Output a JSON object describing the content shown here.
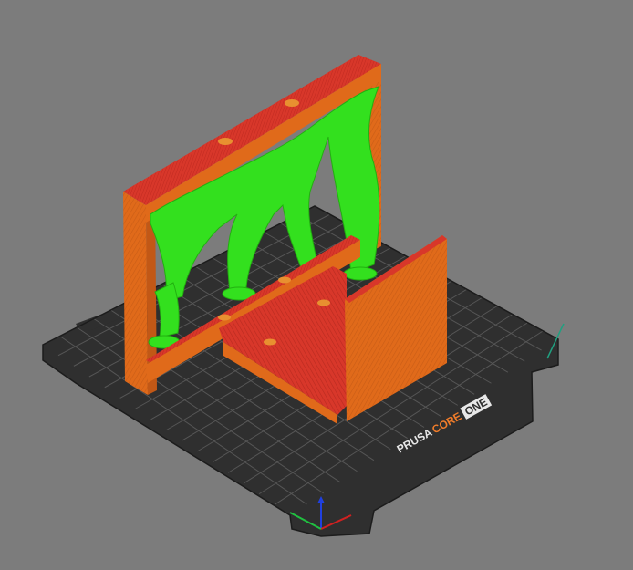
{
  "viewport": {
    "background_color": "#7c7c7c"
  },
  "bed": {
    "brand_part1": "PRUSA",
    "brand_part2": "CORE",
    "brand_part3": "ONE",
    "surface_color": "#2f2f2f",
    "grid_color": "#5a5a5a",
    "brand_accent_color": "#f07c2a"
  },
  "model": {
    "body_color": "#e06a1a",
    "top_layer_color": "#d8372a",
    "support_color": "#33e01e"
  },
  "axes": {
    "x_color": "#d02020",
    "y_color": "#20c040",
    "z_color": "#2040e0"
  },
  "icons": {
    "axes_gizmo": "axes-gizmo-icon",
    "bed_corner": "bed-corner-icon"
  }
}
